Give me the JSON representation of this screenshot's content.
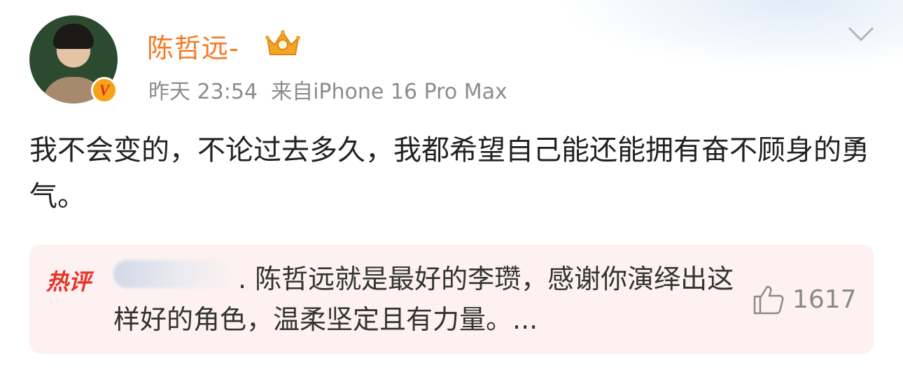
{
  "post": {
    "author": "陈哲远-",
    "time": "昨天 23:54",
    "source": "来自iPhone 16 Pro Max",
    "text": "我不会变的，不论过去多久，我都希望自己能还能拥有奋不顾身的勇气。"
  },
  "hot_comment": {
    "tag": "热评",
    "text": ". 陈哲远就是最好的李瓒，感谢你演绎出这样好的角色，温柔坚定且有力量。...",
    "likes": "1617"
  },
  "icons": {
    "avatar": "avatar",
    "verified": "verified-v-badge",
    "crown": "crown-badge-icon",
    "menu": "chevron-down-icon",
    "like": "thumbs-up-icon"
  },
  "colors": {
    "author": "#f47a24",
    "hot_tag": "#e8322a",
    "hot_bg": "#fdf2f1",
    "meta": "#8c8c8c"
  }
}
